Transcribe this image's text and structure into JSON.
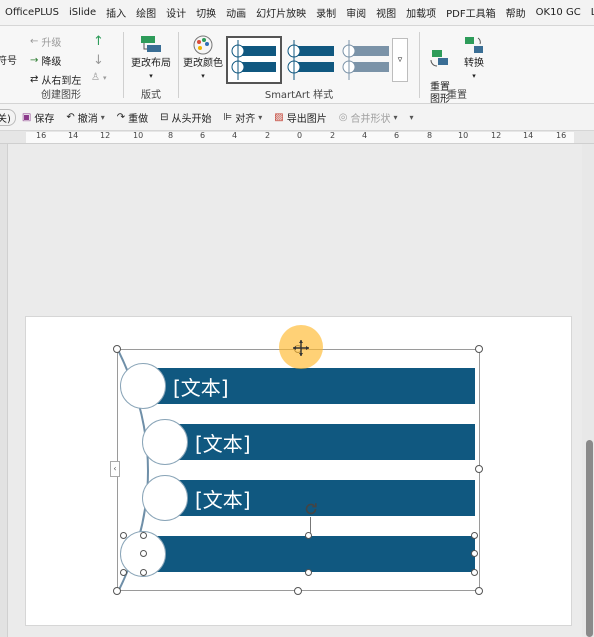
{
  "tabs": [
    "OfficePLUS",
    "iSlide",
    "插入",
    "绘图",
    "设计",
    "切换",
    "动画",
    "幻灯片放映",
    "录制",
    "审阅",
    "视图",
    "加载项",
    "PDF工具箱",
    "帮助",
    "OK10 GC",
    "LvyhT"
  ],
  "ribbon": {
    "create_group": {
      "label": "创建图形",
      "promote": "升级",
      "demote": "降级",
      "right_to_left": "从右到左",
      "bullet": "符号"
    },
    "layout_group": {
      "label": "版式",
      "change_layout": "更改布局"
    },
    "styles_group": {
      "label": "SmartArt 样式",
      "change_colors": "更改颜色",
      "more": "▿"
    },
    "reset_group": {
      "label": "重置",
      "reset_graphic": "重置\n图形",
      "convert": "转换"
    }
  },
  "qat": {
    "close": "关)",
    "save": "保存",
    "undo": "撤消",
    "redo": "重做",
    "from_start": "从头开始",
    "align": "对齐",
    "export_image": "导出图片",
    "merge_shapes": "合并形状"
  },
  "ruler": {
    "ticks": [
      "16",
      "14",
      "12",
      "10",
      "8",
      "6",
      "4",
      "2",
      "0",
      "2",
      "4",
      "6",
      "8",
      "10",
      "12",
      "14",
      "16"
    ]
  },
  "smartart": {
    "items": [
      {
        "text": "[文本]"
      },
      {
        "text": "[文本]"
      },
      {
        "text": "[文本]"
      },
      {
        "text": ""
      }
    ],
    "bar_color": "#105880",
    "collapse_glyph": "‹"
  },
  "colors": {
    "accent": "#105880",
    "cursor_highlight": "#ffb82d"
  }
}
